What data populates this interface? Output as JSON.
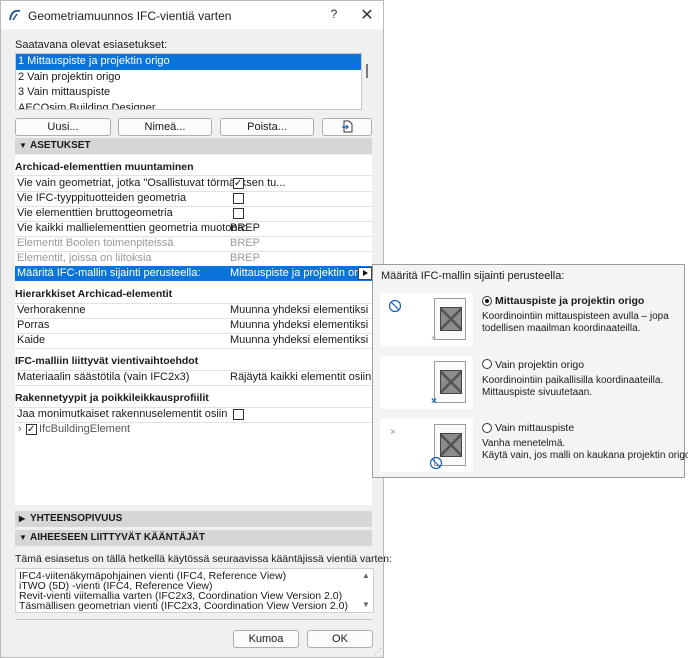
{
  "window": {
    "title": "Geometriamuunnos IFC-vientiä varten",
    "help_label": "?",
    "close_label": "✕"
  },
  "presets": {
    "label": "Saatavana olevat esiasetukset:",
    "items": [
      "1 Mittauspiste ja projektin origo",
      "2 Vain projektin origo",
      "3 Vain mittauspiste",
      "AECOsim Building Designer"
    ],
    "selected_index": 0
  },
  "buttons": {
    "new": "Uusi...",
    "rename": "Nimeä...",
    "delete": "Poista...",
    "cancel": "Kumoa",
    "ok": "OK"
  },
  "sections": {
    "settings": "ASETUKSET",
    "compatibility": "YHTEENSOPIVUUS",
    "translators": "AIHEESEEN LIITTYVÄT KÄÄNTÄJÄT"
  },
  "settings": {
    "group1": "Archicad-elementtien muuntaminen",
    "rows1": [
      {
        "key": "Vie vain geometriat, jotka \"Osallistuvat törmäyksen tu...",
        "checkbox": true
      },
      {
        "key": "Vie IFC-tyyppituotteiden geometria",
        "checkbox": false
      },
      {
        "key": "Vie elementtien bruttogeometria",
        "checkbox": false
      },
      {
        "key": "Vie kaikki mallielementtien geometria muotona:",
        "value": "BREP"
      },
      {
        "key": "Elementit Boolen toimenpiteissä",
        "value": "BREP",
        "disabled": true
      },
      {
        "key": "Elementit, joissa on liitoksia",
        "value": "BREP",
        "disabled": true
      },
      {
        "key": "Määritä IFC-mallin sijainti perusteella:",
        "value": "Mittauspiste ja projektin origo",
        "selected": true
      }
    ],
    "group2": "Hierarkkiset Archicad-elementit",
    "rows2": [
      {
        "key": "Verhorakenne",
        "value": "Muunna yhdeksi elementiksi"
      },
      {
        "key": "Porras",
        "value": "Muunna yhdeksi elementiksi"
      },
      {
        "key": "Kaide",
        "value": "Muunna yhdeksi elementiksi"
      }
    ],
    "group3": "IFC-malliin liittyvät vientivaihtoehdot",
    "rows3": [
      {
        "key": "Materiaalin säästötila (vain IFC2x3)",
        "value": "Räjäytä kaikki elementit osiin, s..."
      }
    ],
    "group4": "Rakennetyypit ja poikkileikkausprofiilit",
    "rows4": [
      {
        "key": "Jaa monimutkaiset rakennuselementit osiin",
        "checkbox": false
      }
    ],
    "tree_item": "IfcBuildingElement"
  },
  "popup": {
    "title": "Määritä IFC-mallin sijainti perusteella:",
    "options": [
      {
        "name": "Mittauspiste ja projektin origo",
        "desc": [
          "Koordinointiin mittauspisteen avulla – jopa",
          "todellisen maailman koordinaateilla."
        ],
        "selected": true
      },
      {
        "name": "Vain projektin origo",
        "desc": [
          "Koordinointiin paikallisilla koordinaateilla.",
          "Mittauspiste sivuutetaan."
        ],
        "selected": false
      },
      {
        "name": "Vain mittauspiste",
        "desc": [
          "Vanha menetelmä.",
          "Käytä vain, jos malli on kaukana projektin origosta."
        ],
        "selected": false
      }
    ]
  },
  "translators": {
    "intro": "Tämä esiasetus on tällä hetkellä käytössä seuraavissa kääntäjissä vientiä varten:",
    "items": [
      "IFC4-viitenäkymäpohjainen vienti (IFC4, Reference View)",
      "iTWO (5D) -vienti (IFC4, Reference View)",
      "Revit-vienti viitemallia varten (IFC2x3, Coordination View Version 2.0)",
      "Täsmällisen geometrian vienti (IFC2x3, Coordination View Version 2.0)"
    ]
  },
  "colors": {
    "accent": "#0a74da",
    "section_bg": "#d6d6d6",
    "dialog_bg": "#f0f0f0"
  },
  "icons": [
    "archicad-app-icon",
    "help-icon",
    "close-icon",
    "import-icon",
    "expand-arrow-icon",
    "survey-point-icon",
    "project-origin-icon",
    "checkbox-checked-icon"
  ]
}
